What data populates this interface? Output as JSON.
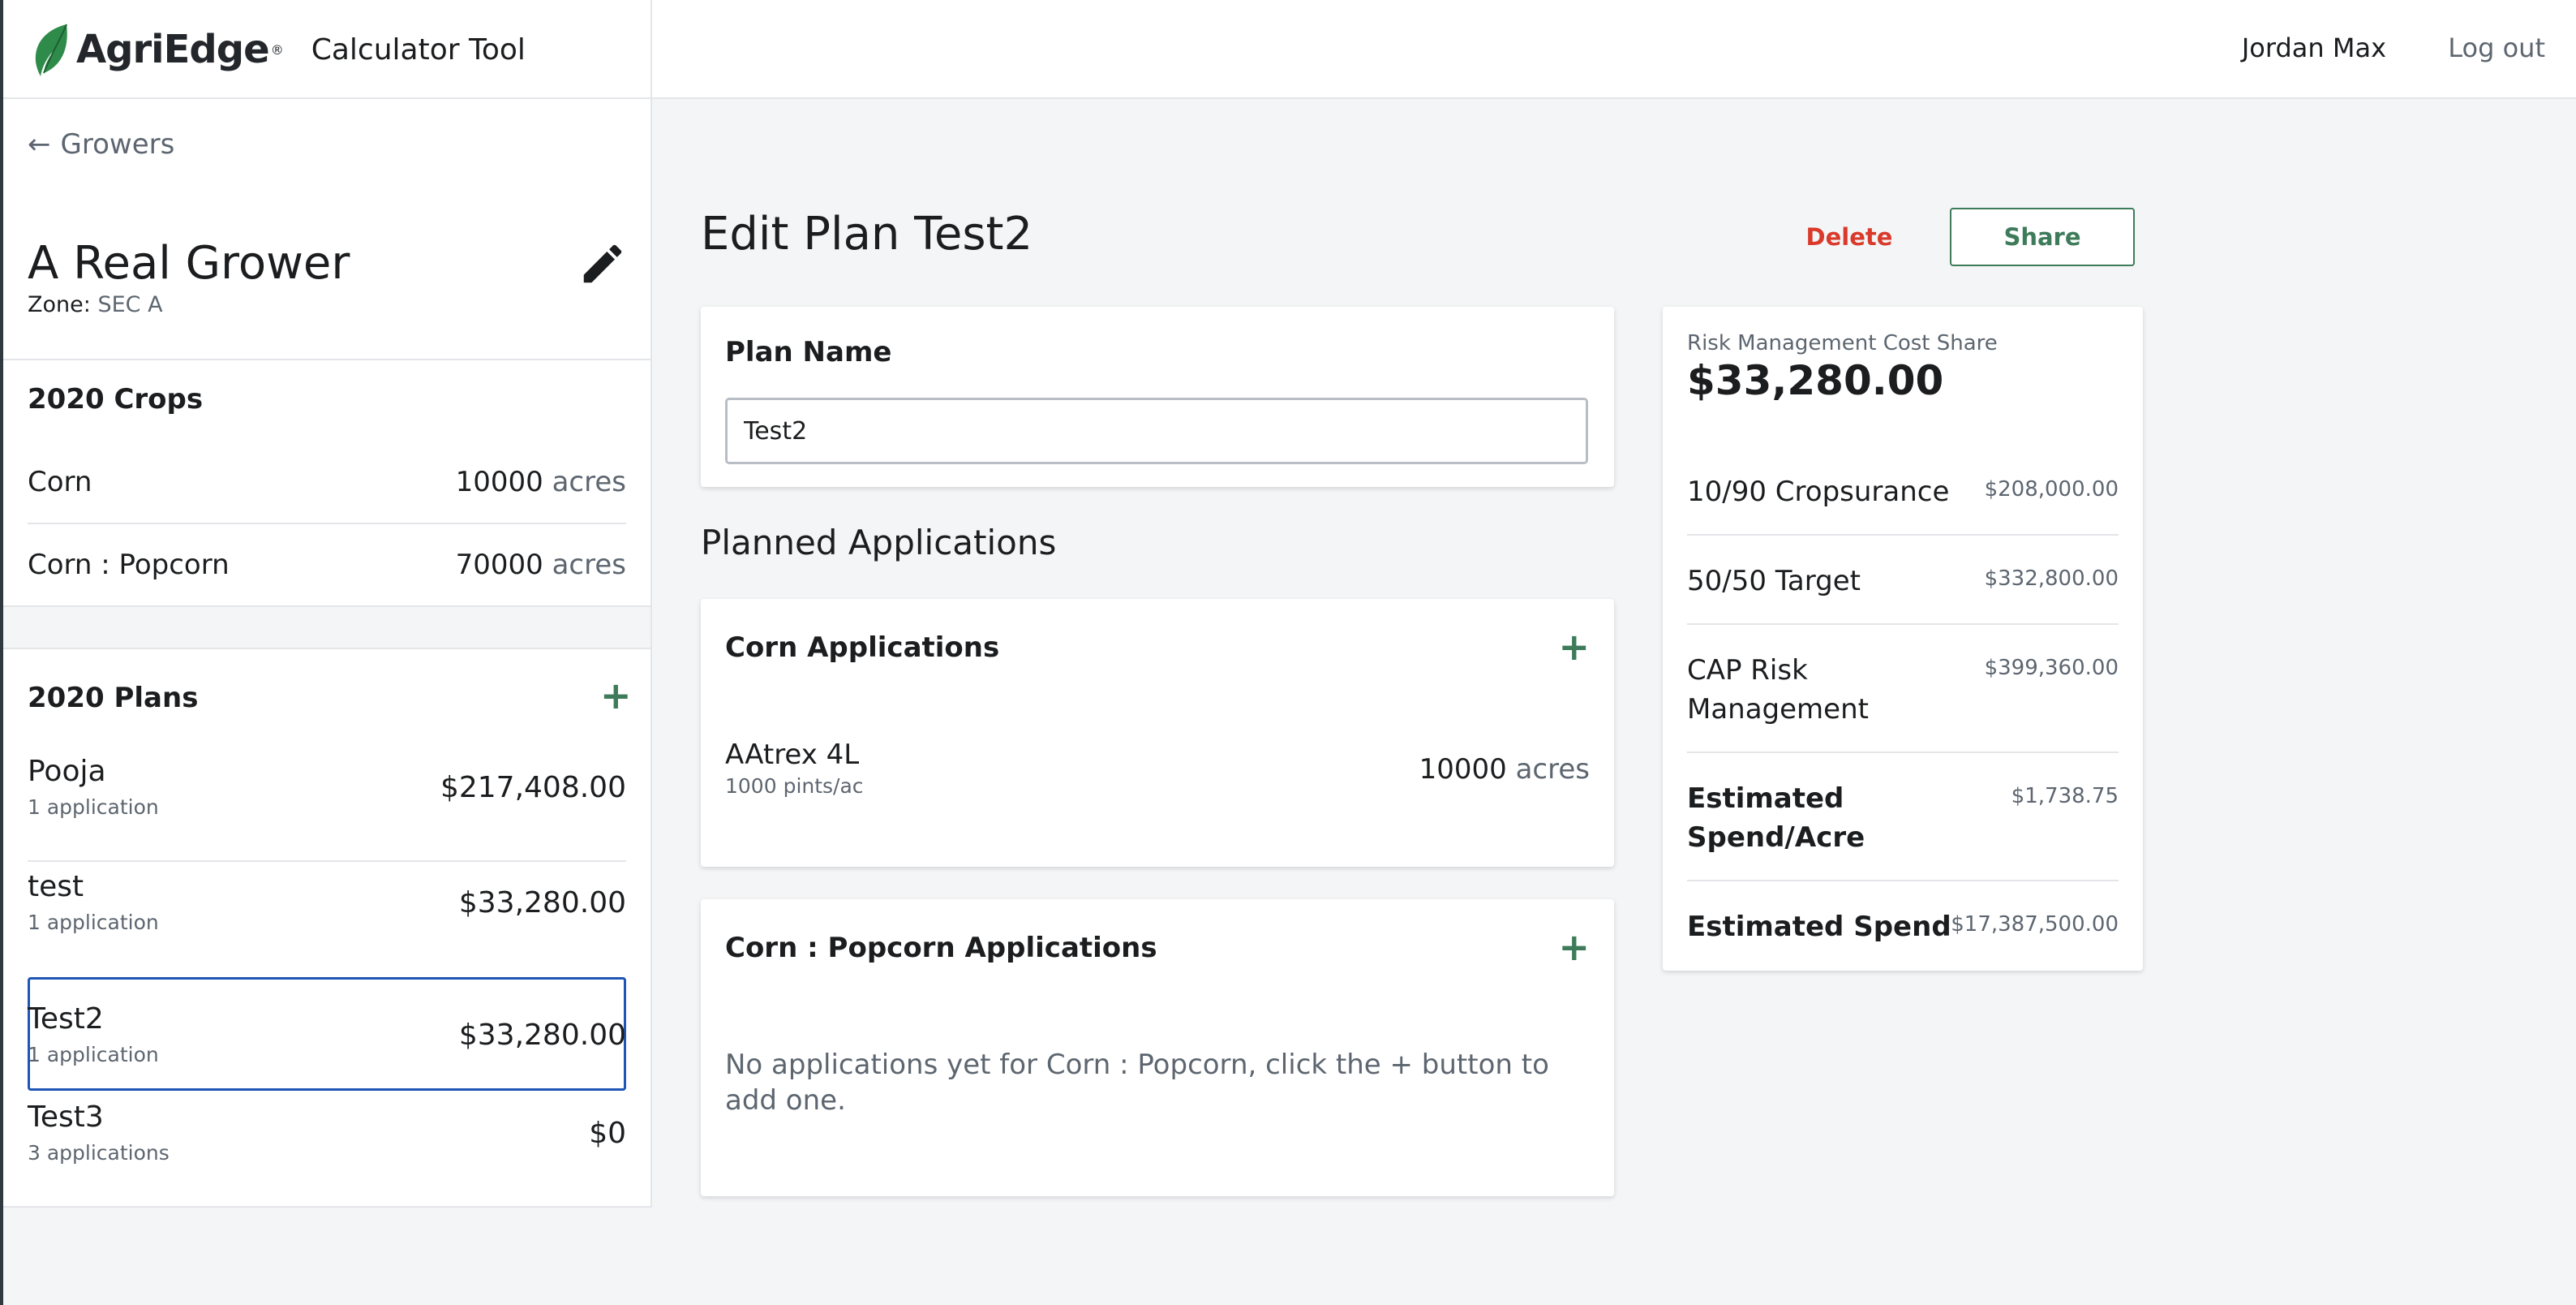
{
  "header": {
    "logo_text": "AgriEdge",
    "logo_mark": "®",
    "app_title": "Calculator Tool",
    "user_name": "Jordan Max",
    "logout_label": "Log out"
  },
  "sidebar": {
    "back_label": "Growers",
    "grower_name": "A Real Grower",
    "zone_label": "Zone:",
    "zone_value": "SEC A",
    "crops_title": "2020 Crops",
    "crops": [
      {
        "name": "Corn",
        "acres": "10000",
        "unit": "acres"
      },
      {
        "name": "Corn : Popcorn",
        "acres": "70000",
        "unit": "acres"
      }
    ],
    "plans_title": "2020 Plans",
    "plans": [
      {
        "name": "Pooja",
        "sub": "1 application",
        "amount": "$217,408.00"
      },
      {
        "name": "test",
        "sub": "1 application",
        "amount": "$33,280.00"
      },
      {
        "name": "Test2",
        "sub": "1 application",
        "amount": "$33,280.00"
      },
      {
        "name": "Test3",
        "sub": "3 applications",
        "amount": "$0"
      }
    ],
    "selected_plan_index": 2
  },
  "main": {
    "heading": "Edit Plan Test2",
    "delete_label": "Delete",
    "share_label": "Share",
    "plan_name_label": "Plan Name",
    "plan_name_value": "Test2",
    "planned_heading": "Planned Applications",
    "corn_card": {
      "title": "Corn Applications",
      "application": {
        "name": "AAtrex 4L",
        "rate": "1000 pints/ac",
        "acres": "10000",
        "unit": "acres"
      }
    },
    "popcorn_card": {
      "title": "Corn : Popcorn Applications",
      "empty_message": "No applications yet for Corn : Popcorn, click the + button to add one."
    }
  },
  "summary": {
    "label": "Risk Management Cost Share",
    "total": "$33,280.00",
    "rows": [
      {
        "label": "10/90 Cropsurance",
        "value": "$208,000.00"
      },
      {
        "label": "50/50 Target",
        "value": "$332,800.00"
      },
      {
        "label": "CAP Risk Management",
        "value": "$399,360.00"
      },
      {
        "label": "Estimated Spend/Acre",
        "value": "$1,738.75"
      },
      {
        "label": "Estimated Spend",
        "value": "$17,387,500.00"
      }
    ]
  },
  "colors": {
    "accent_green": "#3d7b5a",
    "danger_red": "#d93a2b",
    "selection_blue": "#1f55b6",
    "muted_text": "#5d6670"
  },
  "icons": [
    "leaf-logo-icon",
    "arrow-left-icon",
    "pencil-icon",
    "plus-icon"
  ]
}
